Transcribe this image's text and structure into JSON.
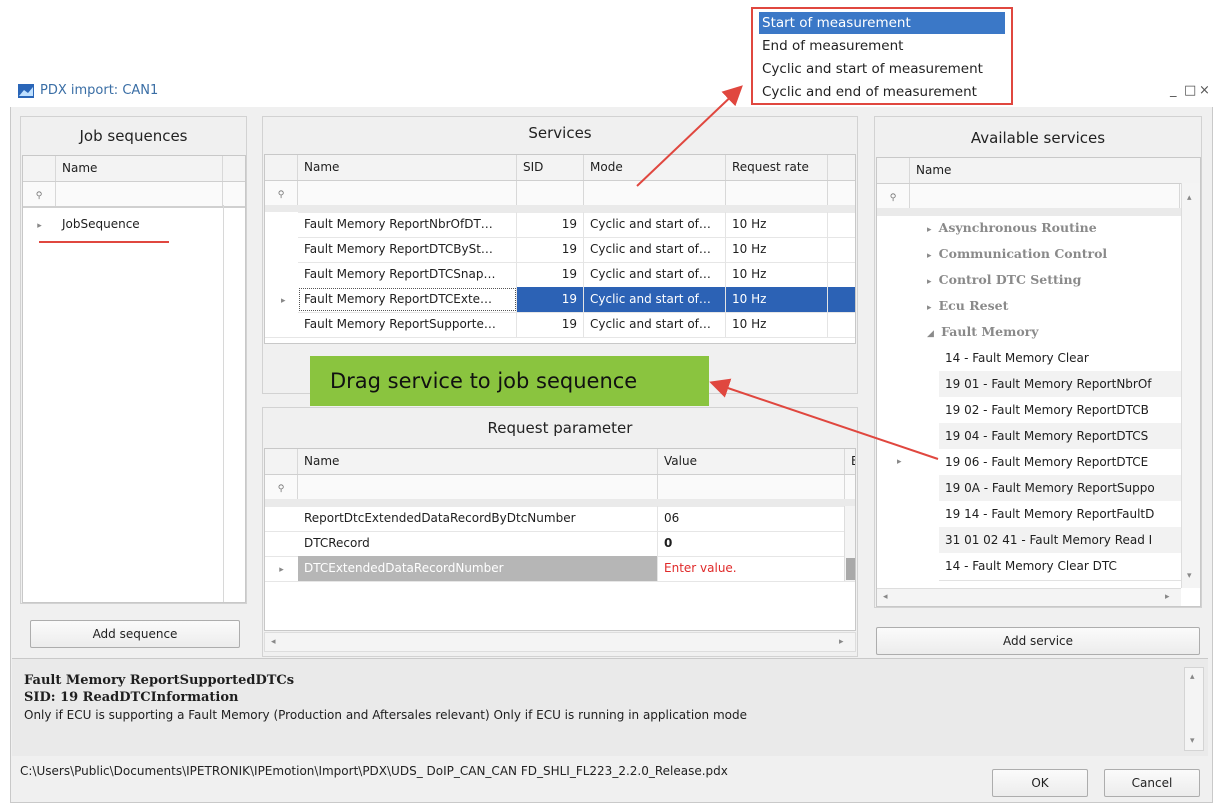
{
  "window": {
    "title": "PDX import: CAN1",
    "controls": [
      "_",
      "□",
      "×"
    ]
  },
  "job_panel": {
    "title": "Job sequences",
    "column": "Name",
    "rows": [
      "JobSequence"
    ],
    "add_label": "Add sequence"
  },
  "services_panel": {
    "title": "Services",
    "columns": [
      "Name",
      "SID",
      "Mode",
      "Request rate"
    ],
    "rows": [
      {
        "name": "Fault Memory ReportNbrOfDT…",
        "sid": "19",
        "mode": "Cyclic and start of…",
        "rate": "10 Hz"
      },
      {
        "name": "Fault Memory ReportDTCBySt…",
        "sid": "19",
        "mode": "Cyclic and start of…",
        "rate": "10 Hz"
      },
      {
        "name": "Fault Memory ReportDTCSnap…",
        "sid": "19",
        "mode": "Cyclic and start of…",
        "rate": "10 Hz"
      },
      {
        "name": "Fault Memory ReportDTCExte…",
        "sid": "19",
        "mode": "Cyclic and start of…",
        "rate": "10 Hz"
      },
      {
        "name": "Fault Memory ReportSupporte…",
        "sid": "19",
        "mode": "Cyclic and start of…",
        "rate": "10 Hz"
      }
    ],
    "selected_row": 3
  },
  "mode_dropdown": {
    "options": [
      "Start of measurement",
      "End of measurement",
      "Cyclic and start of measurement",
      "Cyclic and end of measurement"
    ],
    "selected": 0
  },
  "banner": {
    "text": "Drag service to job sequence"
  },
  "request_panel": {
    "title": "Request parameter",
    "columns": [
      "Name",
      "Value",
      "B"
    ],
    "rows": [
      {
        "name": "ReportDtcExtendedDataRecordByDtcNumber",
        "value": "06"
      },
      {
        "name": "DTCRecord",
        "value": "0"
      },
      {
        "name": "DTCExtendedDataRecordNumber",
        "value": "Enter value."
      }
    ]
  },
  "avail_panel": {
    "title": "Available services",
    "column": "Name",
    "categories": [
      "Asynchronous Routine",
      "Communication Control",
      "Control DTC Setting",
      "Ecu Reset",
      "Fault Memory"
    ],
    "services": [
      "14   - Fault Memory Clear",
      "19  01  - Fault Memory ReportNbrOf",
      "19  02  - Fault Memory ReportDTCB",
      "19  04  - Fault Memory ReportDTCS",
      "19  06  - Fault Memory ReportDTCE",
      "19  0A  - Fault Memory ReportSuppo",
      "19  14  - Fault Memory ReportFaultD",
      "31  01 02 41  - Fault Memory Read I",
      "14   - Fault Memory Clear DTC"
    ],
    "add_label": "Add service"
  },
  "description": {
    "line1": "Fault Memory ReportSupportedDTCs",
    "line2": "SID: 19  ReadDTCInformation",
    "line3": "Only if ECU is supporting a Fault Memory (Production and Aftersales relevant) Only if ECU is running in application mode"
  },
  "footer": {
    "path": "C:\\Users\\Public\\Documents\\IPETRONIK\\IPEmotion\\Import\\PDX\\UDS_ DoIP_CAN_CAN FD_SHLI_FL223_2.2.0_Release.pdx",
    "ok_label": "OK",
    "cancel_label": "Cancel"
  },
  "colors": {
    "selection": "#2c62b5",
    "annotation": "#e0473f",
    "banner": "#8ac43f",
    "error_text": "#e02a2a"
  }
}
